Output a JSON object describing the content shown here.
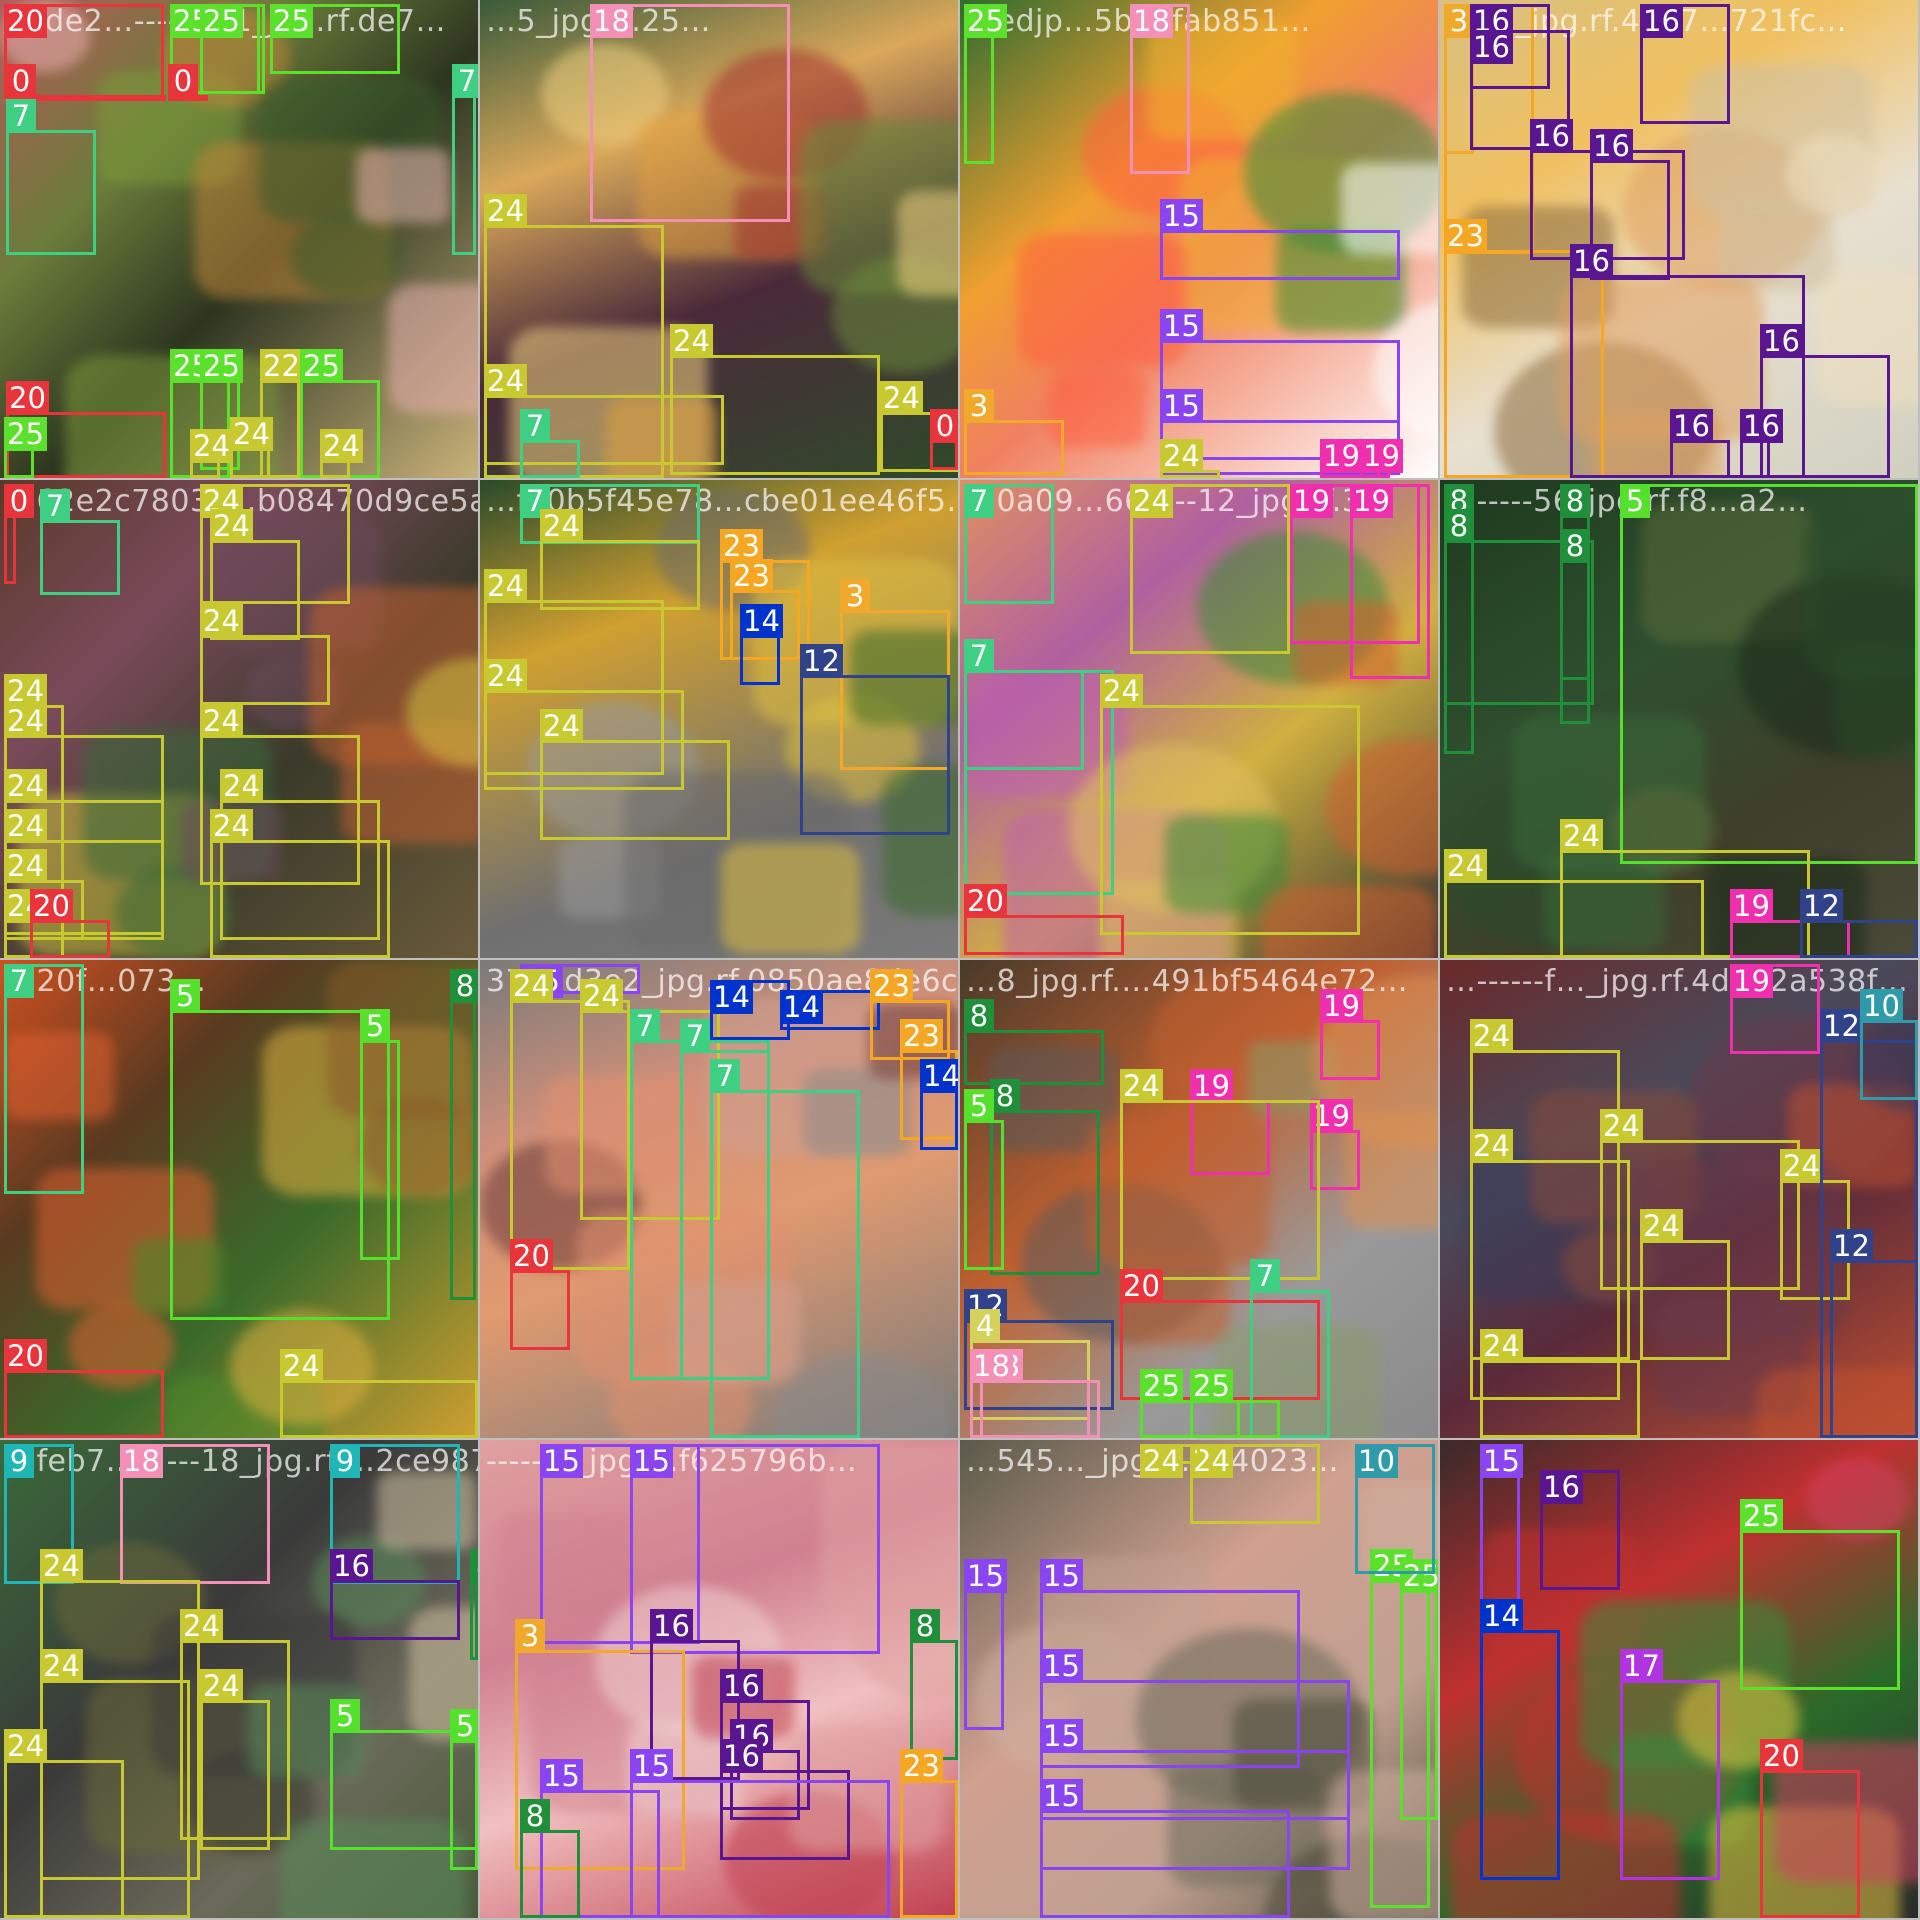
{
  "image": {
    "description_tiles": [
      {
        "caption": "90de2…-------11_jpg.rf.de7…"
      },
      {
        "caption": "…5_jpg.rf.25…"
      },
      {
        "caption": "…edjp…5b29fab851…"
      },
      {
        "caption": "…47_jpg.rf.4637…721fc…"
      },
      {
        "caption": "…62e2c7803c…b08470d9ce5a054…"
      },
      {
        "caption": "…fa0b5f45e78…cbe01ee46f5…"
      },
      {
        "caption": "…0a09…661---12_jpg.rf.3…"
      },
      {
        "caption": "…-----56_jpg.rf.f8…a2…"
      },
      {
        "caption": "…20f…073…"
      },
      {
        "caption": "37d0d3e2_jpg.rf.0850ae8de6c2578486d8700…"
      },
      {
        "caption": "…8_jpg.rf.…491bf5464e72…"
      },
      {
        "caption": "…------f…_jpg.rf.4d022a538f…"
      },
      {
        "caption": "…feb7……---18_jpg.rf.…2ce987119a"
      },
      {
        "caption": "------3_jpg.rf.f625796b…"
      },
      {
        "caption": "…545…_jpg.rf.154023…"
      },
      {
        "caption": ""
      }
    ]
  },
  "class_colors": {
    "0": "#e8353b",
    "3": "#f0a92c",
    "4": "#d4d25a",
    "5": "#54e02c",
    "7": "#3ecf82",
    "8": "#1f8f3a",
    "9": "#1fb6b6",
    "10": "#2e9aaa",
    "12": "#30438a",
    "14": "#0033cc",
    "15": "#8a45f0",
    "16": "#5a1590",
    "17": "#b034e0",
    "18": "#f48fb8",
    "19": "#ef2fae",
    "20": "#e8353b",
    "23": "#f5a623",
    "24": "#c8c831",
    "25": "#5be02b"
  },
  "detections": [
    {
      "tile": 0,
      "cls": "20",
      "label": "20"
    },
    {
      "tile": 0,
      "cls": "25",
      "label": "25"
    },
    {
      "tile": 0,
      "cls": "25",
      "label": "25"
    },
    {
      "tile": 0,
      "cls": "25",
      "label": "25"
    },
    {
      "tile": 0,
      "cls": "0",
      "label": "0"
    },
    {
      "tile": 0,
      "cls": "0",
      "label": "0"
    },
    {
      "tile": 0,
      "cls": "7",
      "label": "7"
    },
    {
      "tile": 0,
      "cls": "7",
      "label": "7"
    },
    {
      "tile": 0,
      "cls": "25",
      "label": "25"
    },
    {
      "tile": 0,
      "cls": "25",
      "label": "25"
    },
    {
      "tile": 0,
      "cls": "22",
      "label": "22"
    },
    {
      "tile": 0,
      "cls": "25",
      "label": "25"
    },
    {
      "tile": 0,
      "cls": "20",
      "label": "20"
    },
    {
      "tile": 0,
      "cls": "25",
      "label": "25"
    },
    {
      "tile": 0,
      "cls": "24",
      "label": "24"
    },
    {
      "tile": 0,
      "cls": "24",
      "label": "24"
    },
    {
      "tile": 0,
      "cls": "24",
      "label": "24"
    },
    {
      "tile": 1,
      "cls": "18",
      "label": "18"
    },
    {
      "tile": 1,
      "cls": "24",
      "label": "24"
    },
    {
      "tile": 1,
      "cls": "24",
      "label": "24"
    },
    {
      "tile": 1,
      "cls": "24",
      "label": "24"
    },
    {
      "tile": 1,
      "cls": "24",
      "label": "24"
    },
    {
      "tile": 1,
      "cls": "0",
      "label": "0"
    },
    {
      "tile": 1,
      "cls": "7",
      "label": "7"
    },
    {
      "tile": 2,
      "cls": "25",
      "label": "25"
    },
    {
      "tile": 2,
      "cls": "18",
      "label": "18"
    },
    {
      "tile": 2,
      "cls": "15",
      "label": "15"
    },
    {
      "tile": 2,
      "cls": "15",
      "label": "15"
    },
    {
      "tile": 2,
      "cls": "15",
      "label": "15"
    },
    {
      "tile": 2,
      "cls": "3",
      "label": "3"
    },
    {
      "tile": 2,
      "cls": "24",
      "label": "24"
    },
    {
      "tile": 2,
      "cls": "19",
      "label": "19"
    },
    {
      "tile": 2,
      "cls": "19",
      "label": "19"
    },
    {
      "tile": 3,
      "cls": "23",
      "label": "23"
    },
    {
      "tile": 3,
      "cls": "23",
      "label": "23"
    },
    {
      "tile": 3,
      "cls": "3",
      "label": "3"
    },
    {
      "tile": 3,
      "cls": "16",
      "label": "16"
    },
    {
      "tile": 3,
      "cls": "16",
      "label": "16"
    },
    {
      "tile": 3,
      "cls": "16",
      "label": "16"
    },
    {
      "tile": 3,
      "cls": "16",
      "label": "16"
    },
    {
      "tile": 3,
      "cls": "16",
      "label": "16"
    },
    {
      "tile": 3,
      "cls": "16",
      "label": "16"
    },
    {
      "tile": 3,
      "cls": "16",
      "label": "16"
    },
    {
      "tile": 3,
      "cls": "16",
      "label": "16"
    },
    {
      "tile": 3,
      "cls": "16",
      "label": "16"
    },
    {
      "tile": 4,
      "cls": "0",
      "label": "0"
    },
    {
      "tile": 4,
      "cls": "7",
      "label": "7"
    },
    {
      "tile": 4,
      "cls": "24",
      "label": "24"
    },
    {
      "tile": 4,
      "cls": "24",
      "label": "24"
    },
    {
      "tile": 4,
      "cls": "24",
      "label": "24"
    },
    {
      "tile": 4,
      "cls": "24",
      "label": "24"
    },
    {
      "tile": 4,
      "cls": "24",
      "label": "24"
    },
    {
      "tile": 4,
      "cls": "24",
      "label": "24"
    },
    {
      "tile": 4,
      "cls": "24",
      "label": "24"
    },
    {
      "tile": 4,
      "cls": "24",
      "label": "24"
    },
    {
      "tile": 4,
      "cls": "24",
      "label": "24"
    },
    {
      "tile": 4,
      "cls": "24",
      "label": "24"
    },
    {
      "tile": 4,
      "cls": "24",
      "label": "24"
    },
    {
      "tile": 4,
      "cls": "24",
      "label": "24"
    },
    {
      "tile": 4,
      "cls": "20",
      "label": "20"
    },
    {
      "tile": 5,
      "cls": "7",
      "label": "7"
    },
    {
      "tile": 5,
      "cls": "24",
      "label": "24"
    },
    {
      "tile": 5,
      "cls": "24",
      "label": "24"
    },
    {
      "tile": 5,
      "cls": "24",
      "label": "24"
    },
    {
      "tile": 5,
      "cls": "24",
      "label": "24"
    },
    {
      "tile": 5,
      "cls": "23",
      "label": "23"
    },
    {
      "tile": 5,
      "cls": "23",
      "label": "23"
    },
    {
      "tile": 5,
      "cls": "14",
      "label": "14"
    },
    {
      "tile": 5,
      "cls": "3",
      "label": "3"
    },
    {
      "tile": 5,
      "cls": "12",
      "label": "12"
    },
    {
      "tile": 6,
      "cls": "7",
      "label": "7"
    },
    {
      "tile": 6,
      "cls": "7",
      "label": "7"
    },
    {
      "tile": 6,
      "cls": "7",
      "label": "7"
    },
    {
      "tile": 6,
      "cls": "19",
      "label": "19"
    },
    {
      "tile": 6,
      "cls": "24",
      "label": "24"
    },
    {
      "tile": 6,
      "cls": "24",
      "label": "24"
    },
    {
      "tile": 6,
      "cls": "20",
      "label": "20"
    },
    {
      "tile": 6,
      "cls": "19",
      "label": "19"
    },
    {
      "tile": 7,
      "cls": "8",
      "label": "8"
    },
    {
      "tile": 7,
      "cls": "8",
      "label": "8"
    },
    {
      "tile": 7,
      "cls": "8",
      "label": "8"
    },
    {
      "tile": 7,
      "cls": "8",
      "label": "8"
    },
    {
      "tile": 7,
      "cls": "5",
      "label": "5"
    },
    {
      "tile": 7,
      "cls": "24",
      "label": "24"
    },
    {
      "tile": 7,
      "cls": "24",
      "label": "24"
    },
    {
      "tile": 7,
      "cls": "19",
      "label": "19"
    },
    {
      "tile": 7,
      "cls": "12",
      "label": "12"
    },
    {
      "tile": 8,
      "cls": "7",
      "label": "7"
    },
    {
      "tile": 8,
      "cls": "5",
      "label": "5"
    },
    {
      "tile": 8,
      "cls": "5",
      "label": "5"
    },
    {
      "tile": 8,
      "cls": "8",
      "label": "8"
    },
    {
      "tile": 8,
      "cls": "20",
      "label": "20"
    },
    {
      "tile": 8,
      "cls": "24",
      "label": "24"
    },
    {
      "tile": 9,
      "cls": "15",
      "label": "15"
    },
    {
      "tile": 9,
      "cls": "24",
      "label": "24"
    },
    {
      "tile": 9,
      "cls": "24",
      "label": "24"
    },
    {
      "tile": 9,
      "cls": "7",
      "label": "7"
    },
    {
      "tile": 9,
      "cls": "7",
      "label": "7"
    },
    {
      "tile": 9,
      "cls": "7",
      "label": "7"
    },
    {
      "tile": 9,
      "cls": "14",
      "label": "14"
    },
    {
      "tile": 9,
      "cls": "14",
      "label": "14"
    },
    {
      "tile": 9,
      "cls": "20",
      "label": "20"
    },
    {
      "tile": 9,
      "cls": "23",
      "label": "23"
    },
    {
      "tile": 9,
      "cls": "23",
      "label": "23"
    },
    {
      "tile": 9,
      "cls": "14",
      "label": "14"
    },
    {
      "tile": 10,
      "cls": "8",
      "label": "8"
    },
    {
      "tile": 10,
      "cls": "8",
      "label": "8"
    },
    {
      "tile": 10,
      "cls": "5",
      "label": "5"
    },
    {
      "tile": 10,
      "cls": "19",
      "label": "19"
    },
    {
      "tile": 10,
      "cls": "19",
      "label": "19"
    },
    {
      "tile": 10,
      "cls": "19",
      "label": "19"
    },
    {
      "tile": 10,
      "cls": "24",
      "label": "24"
    },
    {
      "tile": 10,
      "cls": "12",
      "label": "12"
    },
    {
      "tile": 10,
      "cls": "4",
      "label": "4"
    },
    {
      "tile": 10,
      "cls": "18",
      "label": "18"
    },
    {
      "tile": 10,
      "cls": "18",
      "label": "18"
    },
    {
      "tile": 10,
      "cls": "20",
      "label": "20"
    },
    {
      "tile": 10,
      "cls": "7",
      "label": "7"
    },
    {
      "tile": 10,
      "cls": "25",
      "label": "25"
    },
    {
      "tile": 10,
      "cls": "25",
      "label": "25"
    },
    {
      "tile": 11,
      "cls": "24",
      "label": "24"
    },
    {
      "tile": 11,
      "cls": "24",
      "label": "24"
    },
    {
      "tile": 11,
      "cls": "24",
      "label": "24"
    },
    {
      "tile": 11,
      "cls": "24",
      "label": "24"
    },
    {
      "tile": 11,
      "cls": "24",
      "label": "24"
    },
    {
      "tile": 11,
      "cls": "24",
      "label": "24"
    },
    {
      "tile": 11,
      "cls": "19",
      "label": "19"
    },
    {
      "tile": 11,
      "cls": "12",
      "label": "12"
    },
    {
      "tile": 11,
      "cls": "10",
      "label": "10"
    },
    {
      "tile": 11,
      "cls": "12",
      "label": "12"
    },
    {
      "tile": 12,
      "cls": "9",
      "label": "9"
    },
    {
      "tile": 12,
      "cls": "18",
      "label": "18"
    },
    {
      "tile": 12,
      "cls": "9",
      "label": "9"
    },
    {
      "tile": 12,
      "cls": "24",
      "label": "24"
    },
    {
      "tile": 12,
      "cls": "16",
      "label": "16"
    },
    {
      "tile": 12,
      "cls": "24",
      "label": "24"
    },
    {
      "tile": 12,
      "cls": "24",
      "label": "24"
    },
    {
      "tile": 12,
      "cls": "24",
      "label": "24"
    },
    {
      "tile": 12,
      "cls": "5",
      "label": "5"
    },
    {
      "tile": 12,
      "cls": "5",
      "label": "5"
    },
    {
      "tile": 12,
      "cls": "8",
      "label": "8"
    },
    {
      "tile": 12,
      "cls": "24",
      "label": "24"
    },
    {
      "tile": 13,
      "cls": "15",
      "label": "15"
    },
    {
      "tile": 13,
      "cls": "15",
      "label": "15"
    },
    {
      "tile": 13,
      "cls": "3",
      "label": "3"
    },
    {
      "tile": 13,
      "cls": "16",
      "label": "16"
    },
    {
      "tile": 13,
      "cls": "16",
      "label": "16"
    },
    {
      "tile": 13,
      "cls": "16",
      "label": "16"
    },
    {
      "tile": 13,
      "cls": "16",
      "label": "16"
    },
    {
      "tile": 13,
      "cls": "15",
      "label": "15"
    },
    {
      "tile": 13,
      "cls": "15",
      "label": "15"
    },
    {
      "tile": 13,
      "cls": "8",
      "label": "8"
    },
    {
      "tile": 13,
      "cls": "8",
      "label": "8"
    },
    {
      "tile": 13,
      "cls": "23",
      "label": "23"
    },
    {
      "tile": 14,
      "cls": "15",
      "label": "15"
    },
    {
      "tile": 14,
      "cls": "15",
      "label": "15"
    },
    {
      "tile": 14,
      "cls": "15",
      "label": "15"
    },
    {
      "tile": 14,
      "cls": "15",
      "label": "15"
    },
    {
      "tile": 14,
      "cls": "15",
      "label": "15"
    },
    {
      "tile": 14,
      "cls": "25",
      "label": "25"
    },
    {
      "tile": 14,
      "cls": "25",
      "label": "25"
    },
    {
      "tile": 14,
      "cls": "10",
      "label": "10"
    },
    {
      "tile": 14,
      "cls": "24",
      "label": "24"
    },
    {
      "tile": 14,
      "cls": "24",
      "label": "24"
    },
    {
      "tile": 15,
      "cls": "15",
      "label": "15"
    },
    {
      "tile": 15,
      "cls": "16",
      "label": "16"
    },
    {
      "tile": 15,
      "cls": "14",
      "label": "14"
    },
    {
      "tile": 15,
      "cls": "17",
      "label": "17"
    },
    {
      "tile": 15,
      "cls": "20",
      "label": "20"
    },
    {
      "tile": 15,
      "cls": "25",
      "label": "25"
    }
  ]
}
